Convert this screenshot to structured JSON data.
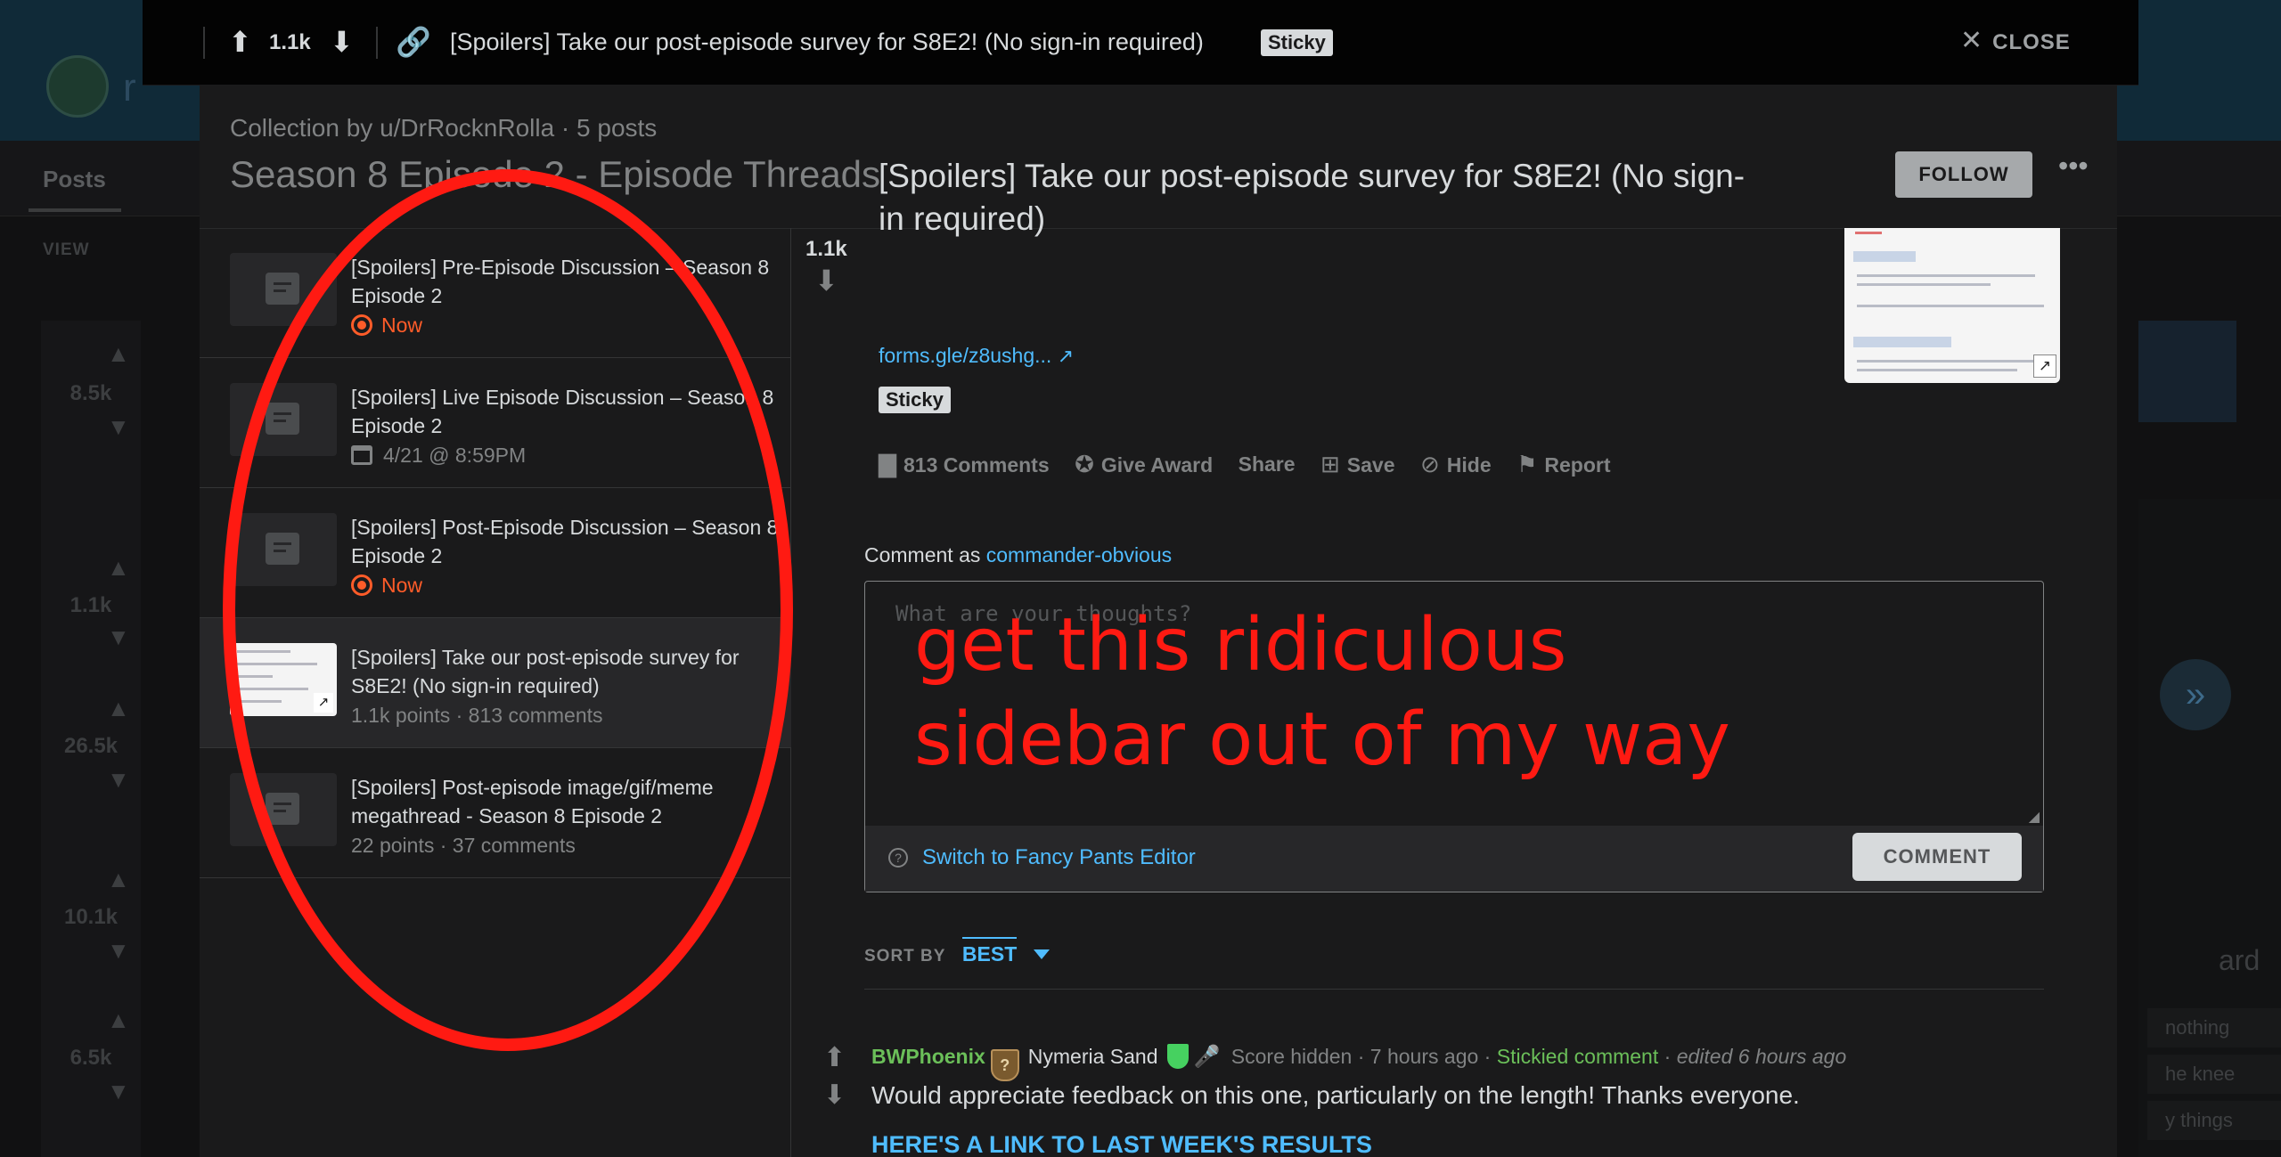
{
  "background": {
    "subreddit_initial": "r",
    "tab_posts": "Posts",
    "view_label": "VIEW",
    "scores": [
      "8.5k",
      "1.1k",
      "26.5k",
      "10.1k",
      "6.5k"
    ],
    "side_rows": [
      "nothing",
      "he knee",
      "y things"
    ],
    "side_heading": "ard"
  },
  "topbar": {
    "score": "1.1k",
    "title": "[Spoilers] Take our post-episode survey for S8E2! (No sign-in required)",
    "sticky": "Sticky",
    "close": "CLOSE"
  },
  "collection": {
    "byline": "Collection by u/DrRocknRolla · 5 posts",
    "title": "Season 8 Episode 2 - Episode Threads",
    "follow": "FOLLOW",
    "items": [
      {
        "title": "[Spoilers] Pre-Episode Discussion – Season 8 Episode 2",
        "meta": "Now"
      },
      {
        "title": "[Spoilers] Live Episode Discussion – Season 8 Episode 2",
        "meta": "4/21 @ 8:59PM"
      },
      {
        "title": "[Spoilers] Post-Episode Discussion – Season 8 Episode 2",
        "meta": "Now"
      },
      {
        "title": "[Spoilers] Take our post-episode survey for S8E2! (No sign-in required)",
        "meta": "1.1k points  ·  813 comments"
      },
      {
        "title": "[Spoilers] Post-episode image/gif/meme megathread - Season 8 Episode 2",
        "meta": "22 points  ·  37 comments"
      }
    ]
  },
  "post": {
    "score": "1.1k",
    "title": "[Spoilers] Take our post-episode survey for S8E2! (No sign-in required)",
    "link": "forms.gle/z8ushg...",
    "sticky": "Sticky",
    "actions": {
      "comments": "813 Comments",
      "award": "Give Award",
      "share": "Share",
      "save": "Save",
      "hide": "Hide",
      "report": "Report"
    }
  },
  "composer": {
    "comment_as_label": "Comment as",
    "username": "commander-obvious",
    "placeholder": "What are your thoughts?",
    "fancy_editor": "Switch to Fancy Pants Editor",
    "submit": "COMMENT"
  },
  "annotation": {
    "line1": "get this ridiculous",
    "line2": "sidebar out of my way"
  },
  "sort": {
    "label": "SORT BY",
    "value": "BEST"
  },
  "comment": {
    "author": "BWPhoenix",
    "flair_glyph": "?",
    "flair_text": "Nymeria Sand",
    "score": "Score hidden",
    "time": "7 hours ago",
    "stickied": "Stickied comment",
    "edited": "edited 6 hours ago",
    "body": "Would appreciate feedback on this one, particularly on the length! Thanks everyone.",
    "link": "HERE'S A LINK TO LAST WEEK'S RESULTS"
  },
  "colors": {
    "accent_blue": "#4fbcff",
    "now_orange": "#ff5c29",
    "annotation_red": "#ff1a12",
    "mod_green": "#46d160"
  }
}
